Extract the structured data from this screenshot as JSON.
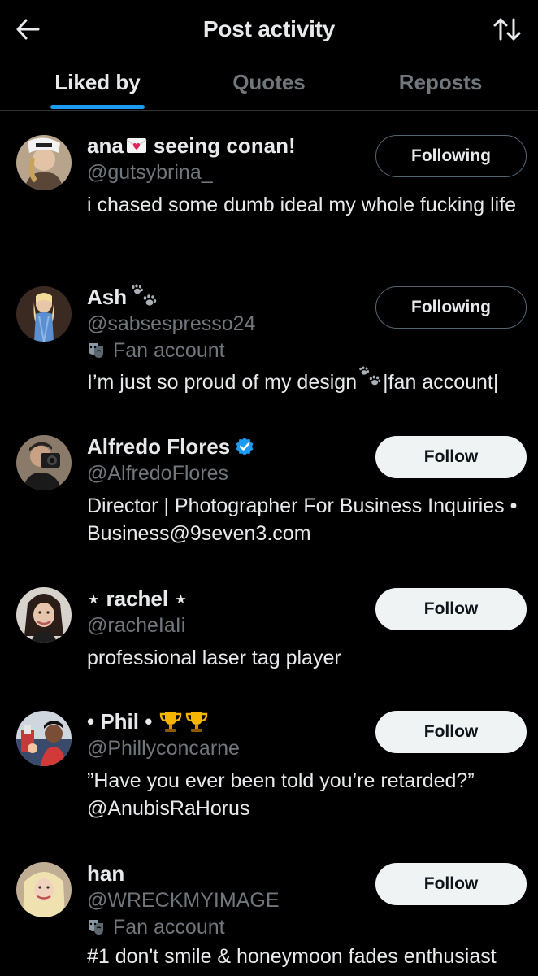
{
  "header": {
    "title": "Post activity",
    "back_icon": "arrow-left-icon",
    "sort_icon": "sort-arrows-icon"
  },
  "tabs": [
    {
      "label": "Liked by",
      "active": true
    },
    {
      "label": "Quotes",
      "active": false
    },
    {
      "label": "Reposts",
      "active": false
    }
  ],
  "colors": {
    "accent": "#1d9bf0",
    "background": "#000000",
    "text": "#e7e9ea",
    "muted": "#71767b",
    "verified": "#1d9bf0"
  },
  "users": [
    {
      "name": "ana",
      "name_suffix": "seeing conan!",
      "handle": "@gutsybrina_",
      "button": "Following",
      "bio": "i chased some dumb ideal my whole fucking life"
    },
    {
      "name": "Ash",
      "handle": "@sabsespresso24",
      "fan_label": "Fan account",
      "button": "Following",
      "bio_before": "I’m just so proud of my design",
      "bio_after": "|fan account|"
    },
    {
      "name": "Alfredo Flores",
      "verified": true,
      "handle": "@AlfredoFlores",
      "button": "Follow",
      "bio": "Director | Photographer For Business Inquiries • Business@9seven3.com"
    },
    {
      "name": "⋆ rachel ⋆",
      "handle": "@racheIaIi",
      "button": "Follow",
      "bio": "professional laser tag player"
    },
    {
      "name": "• Phil •",
      "handle": "@Phillyconcarne",
      "button": "Follow",
      "bio": "”Have you ever been told you’re retarded?” @AnubisRaHorus"
    },
    {
      "name": "han",
      "handle": "@WRECKMYIMAGE",
      "fan_label": "Fan account",
      "button": "Follow",
      "bio": "#1 don't smile & honeymoon fades enthusiast"
    }
  ]
}
